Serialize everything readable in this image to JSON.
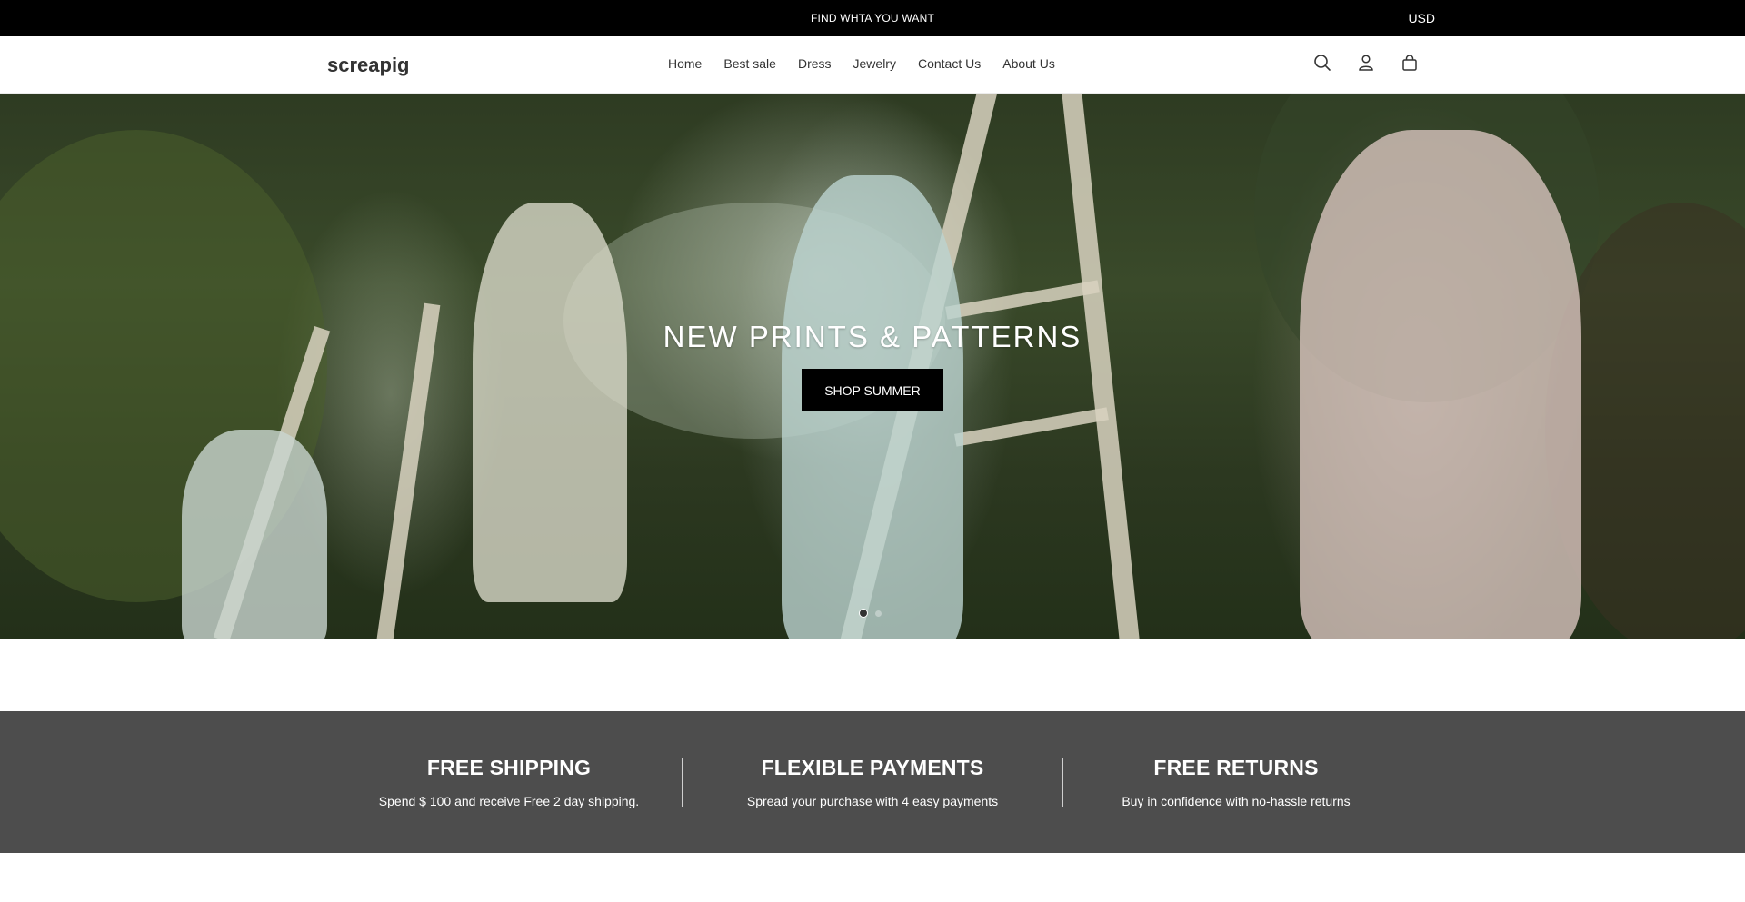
{
  "announcement": {
    "message": "FIND WHTA YOU WANT",
    "currency": "USD"
  },
  "header": {
    "logo": "screapig",
    "nav": [
      "Home",
      "Best sale",
      "Dress",
      "Jewelry",
      "Contact Us",
      "About Us"
    ],
    "icons": [
      "search-icon",
      "account-icon",
      "cart-icon"
    ]
  },
  "hero": {
    "title": "NEW PRINTS & PATTERNS",
    "button": "SHOP SUMMER",
    "slides": 2,
    "active_slide": 1
  },
  "features": [
    {
      "title": "FREE SHIPPING",
      "desc": "Spend $ 100 and receive Free 2 day shipping."
    },
    {
      "title": "FLEXIBLE PAYMENTS",
      "desc": "Spread your purchase with 4 easy payments"
    },
    {
      "title": "FREE RETURNS",
      "desc": "Buy in confidence with no-hassle returns"
    }
  ],
  "colors": {
    "topbar": "#000000",
    "features_bg": "#4d4d4d",
    "button": "#000000"
  }
}
